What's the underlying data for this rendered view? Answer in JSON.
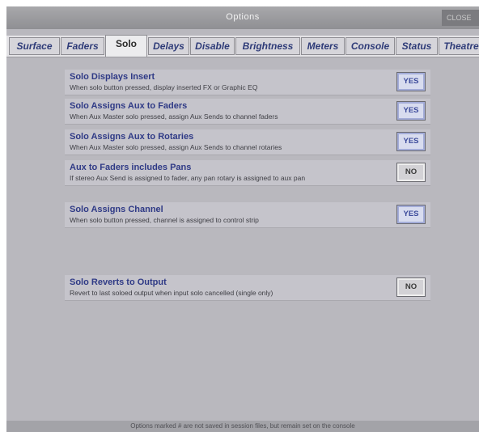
{
  "window": {
    "title": "Options",
    "close_label": "CLOSE"
  },
  "tabs": [
    {
      "label": "Surface",
      "active": false
    },
    {
      "label": "Faders",
      "active": false
    },
    {
      "label": "Solo",
      "active": true
    },
    {
      "label": "Delays",
      "active": false
    },
    {
      "label": "Disable",
      "active": false
    },
    {
      "label": "Brightness",
      "active": false
    },
    {
      "label": "Meters",
      "active": false
    },
    {
      "label": "Console",
      "active": false
    },
    {
      "label": "Status",
      "active": false
    },
    {
      "label": "Theatre",
      "active": false
    }
  ],
  "options": [
    {
      "title": "Solo Displays Insert",
      "description": "When solo button pressed, display inserted FX or Graphic EQ",
      "value": "YES"
    },
    {
      "title": "Solo Assigns Aux to Faders",
      "description": "When Aux Master solo pressed, assign Aux Sends to channel faders",
      "value": "YES"
    },
    {
      "title": "Solo Assigns Aux to Rotaries",
      "description": "When Aux Master solo pressed, assign Aux Sends to channel rotaries",
      "value": "YES"
    },
    {
      "title": "Aux to Faders includes Pans",
      "description": "If stereo Aux Send is assigned to fader, any pan rotary is assigned to aux pan",
      "value": "NO"
    },
    {
      "title": "Solo Assigns Channel",
      "description": "When solo button pressed, channel is assigned to control strip",
      "value": "YES"
    },
    {
      "title": "Solo Reverts to Output",
      "description": "Revert to last soloed output when input solo cancelled (single only)",
      "value": "NO"
    }
  ],
  "footer": {
    "note": "Options marked # are not saved in session files, but remain set on the console"
  }
}
